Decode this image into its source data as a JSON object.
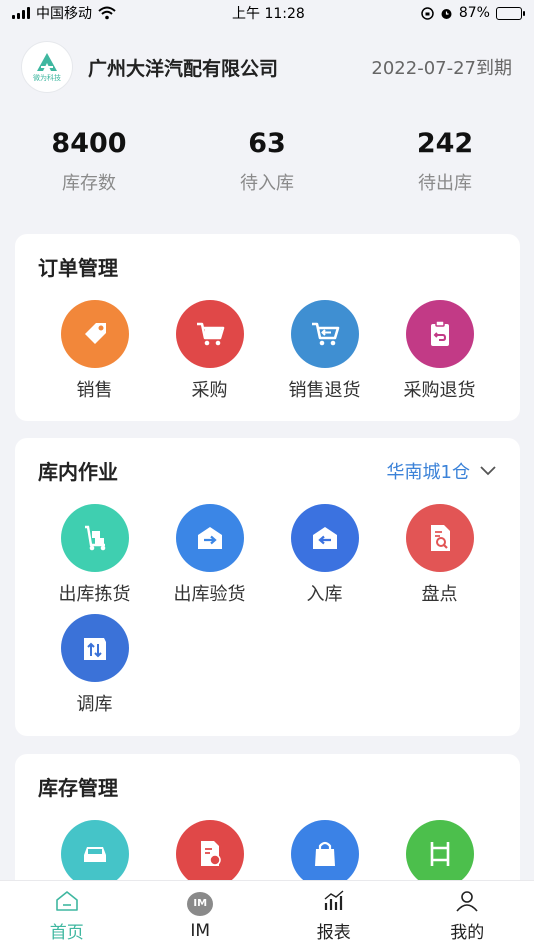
{
  "status_bar": {
    "carrier": "中国移动",
    "time": "上午 11:28",
    "battery": "87%"
  },
  "header": {
    "company": "广州大洋汽配有限公司",
    "expire": "2022-07-27到期",
    "logo_text": "微为科技"
  },
  "stats": [
    {
      "value": "8400",
      "label": "库存数"
    },
    {
      "value": "63",
      "label": "待入库"
    },
    {
      "value": "242",
      "label": "待出库"
    }
  ],
  "order_mgmt": {
    "title": "订单管理",
    "items": [
      {
        "label": "销售",
        "icon": "tag-icon",
        "color": "#f2873a"
      },
      {
        "label": "采购",
        "icon": "cart-icon",
        "color": "#e04848"
      },
      {
        "label": "销售退货",
        "icon": "cart-return-icon",
        "color": "#3f8fd2"
      },
      {
        "label": "采购退货",
        "icon": "clipboard-return-icon",
        "color": "#c23a86"
      }
    ]
  },
  "warehouse_ops": {
    "title": "库内作业",
    "warehouse": "华南城1仓",
    "items": [
      {
        "label": "出库拣货",
        "icon": "handcart-icon",
        "color": "#3fcfb0"
      },
      {
        "label": "出库验货",
        "icon": "warehouse-out-icon",
        "color": "#3b86e6"
      },
      {
        "label": "入库",
        "icon": "warehouse-in-icon",
        "color": "#3b72e0"
      },
      {
        "label": "盘点",
        "icon": "document-search-icon",
        "color": "#e25555"
      },
      {
        "label": "调库",
        "icon": "transfer-icon",
        "color": "#3b72d8"
      }
    ]
  },
  "inventory_mgmt": {
    "title": "库存管理",
    "items": [
      {
        "icon": "car-icon",
        "color": "#45c4c8"
      },
      {
        "icon": "document-return-icon",
        "color": "#e04848"
      },
      {
        "icon": "bag-icon",
        "color": "#3b82e6"
      },
      {
        "icon": "shelf-icon",
        "color": "#4cbf4c"
      }
    ]
  },
  "tabbar": [
    {
      "label": "首页",
      "icon": "home-icon",
      "active": true
    },
    {
      "label": "IM",
      "icon": "im-icon",
      "icon_text": "IM",
      "active": false
    },
    {
      "label": "报表",
      "icon": "chart-icon",
      "active": false
    },
    {
      "label": "我的",
      "icon": "user-icon",
      "active": false
    }
  ]
}
